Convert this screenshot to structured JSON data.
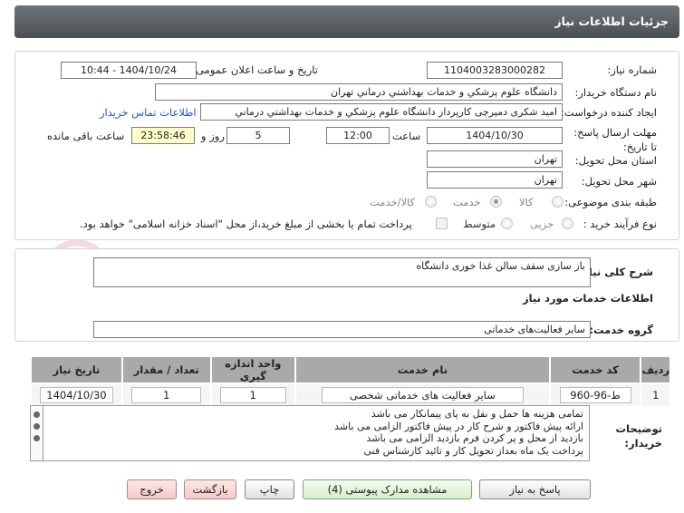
{
  "page": {
    "title": "جزئیات اطلاعات نیاز"
  },
  "form": {
    "need_number_label": "شماره نیاز:",
    "need_number": "1104003283000282",
    "announce_label": "تاریخ و ساعت اعلان عمومی:",
    "announce_value": "1404/10/24 - 10:44",
    "buyer_org_label": "نام دستگاه خریدار:",
    "buyer_org": "دانشگاه علوم پزشکي و خدمات بهداشتي درماني تهران",
    "creator_label": "ایجاد کننده درخواست:",
    "creator": "امید شکری دمیرچی کارپرداز دانشگاه علوم پزشکي و خدمات بهداشتي درماني",
    "contact_link": "اطلاعات تماس خریدار",
    "deadline_label": "مهلت ارسال پاسخ: تا تاریخ:",
    "deadline_date": "1404/10/30",
    "time_label": "ساعت",
    "deadline_time": "12:00",
    "days_value": "5",
    "days_label": "روز و",
    "remaining_time": "23:58:46",
    "remaining_label": "ساعت باقی مانده",
    "province_label": "استان محل تحویل:",
    "province": "تهران",
    "city_label": "شهر محل تحویل:",
    "city": "تهران",
    "category_label": "طبقه بندی موضوعی:",
    "category_options": [
      "کالا",
      "خدمت",
      "کالا/خدمت"
    ],
    "category_selected": "خدمت",
    "process_label": "نوع فرآیند خرید :",
    "process_options": [
      "جزیی",
      "متوسط"
    ],
    "process_selected": "متوسط",
    "payment_note": "پرداخت تمام یا بخشی از مبلغ خرید،از محل \"اسناد خزانه اسلامی\" خواهد بود."
  },
  "general_desc": {
    "label": "شرح کلی نیاز:",
    "value": "باز سازی سقف سالن غذا خوری دانشگاه"
  },
  "services_section": {
    "title": "اطلاعات خدمات مورد نیاز"
  },
  "service_group": {
    "label": "گروه خدمت:",
    "value": "سایر فعالیت‌های خدماتی"
  },
  "services_table": {
    "columns": [
      "ردیف",
      "کد خدمت",
      "نام خدمت",
      "واحد اندازه گیری",
      "تعداد / مقدار",
      "تاریخ نیاز"
    ],
    "rows": [
      {
        "row": "1",
        "code": "ط-96-960",
        "name": "سایر فعالیت های خدماتی شخصی",
        "unit": "1",
        "qty": "1",
        "date": "1404/10/30"
      }
    ]
  },
  "buyer_notes": {
    "label": "توضیحات خریدار:",
    "lines": [
      "تمامی هزینه ها حمل و نقل به پای پیمانکار می باشد",
      "ارائه پیش فاکتور  و شرح کار در پیش فاکتور الزامی می باشد",
      "بازدید از محل و پر کردن فرم بازدید الزامی می باشد",
      "پرداخت یک ماه بعداز تحویل کار و تائید کارشناس فنی"
    ]
  },
  "buttons": {
    "reply": "پاسخ به نیاز",
    "attachments": "مشاهده مدارک پیوستی (4)",
    "print": "چاپ",
    "back": "بازگشت",
    "exit": "خروج"
  },
  "watermark": {
    "text": "AriaTender.net"
  },
  "colors": {
    "titlebar": "#5a5f64",
    "table_header": "#a9a9a9",
    "remaining_bg": "#ffffc8",
    "link": "#2255cc"
  }
}
